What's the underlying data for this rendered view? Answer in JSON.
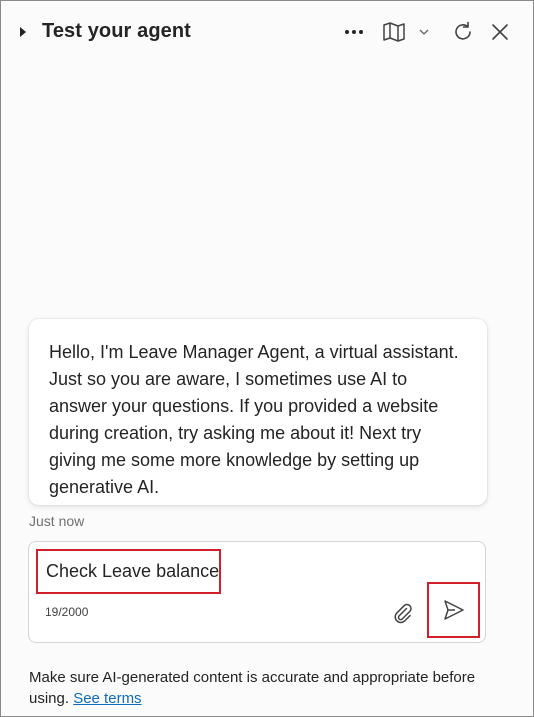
{
  "header": {
    "title": "Test your agent",
    "icons": {
      "collapse": "caret-right-icon",
      "more": "more-horizontal-icon",
      "map": "map-icon",
      "chevron": "chevron-down-icon",
      "refresh": "refresh-icon",
      "close": "close-icon"
    }
  },
  "conversation": {
    "bot_message": "Hello, I'm Leave Manager Agent, a virtual assistant. Just so you are aware, I sometimes use AI to answer your questions. If you provided a website during creation, try asking me about it! Next try giving me some more knowledge by setting up generative AI.",
    "timestamp": "Just now"
  },
  "composer": {
    "input_value": "Check Leave balance",
    "char_count": "19/2000",
    "attach_icon": "paperclip-icon",
    "send_icon": "send-icon",
    "highlight_color": "#d21f2b"
  },
  "footer": {
    "disclaimer": "Make sure AI-generated content is accurate and appropriate before using.",
    "link_label": "See terms",
    "link_color": "#0f6cbd"
  }
}
